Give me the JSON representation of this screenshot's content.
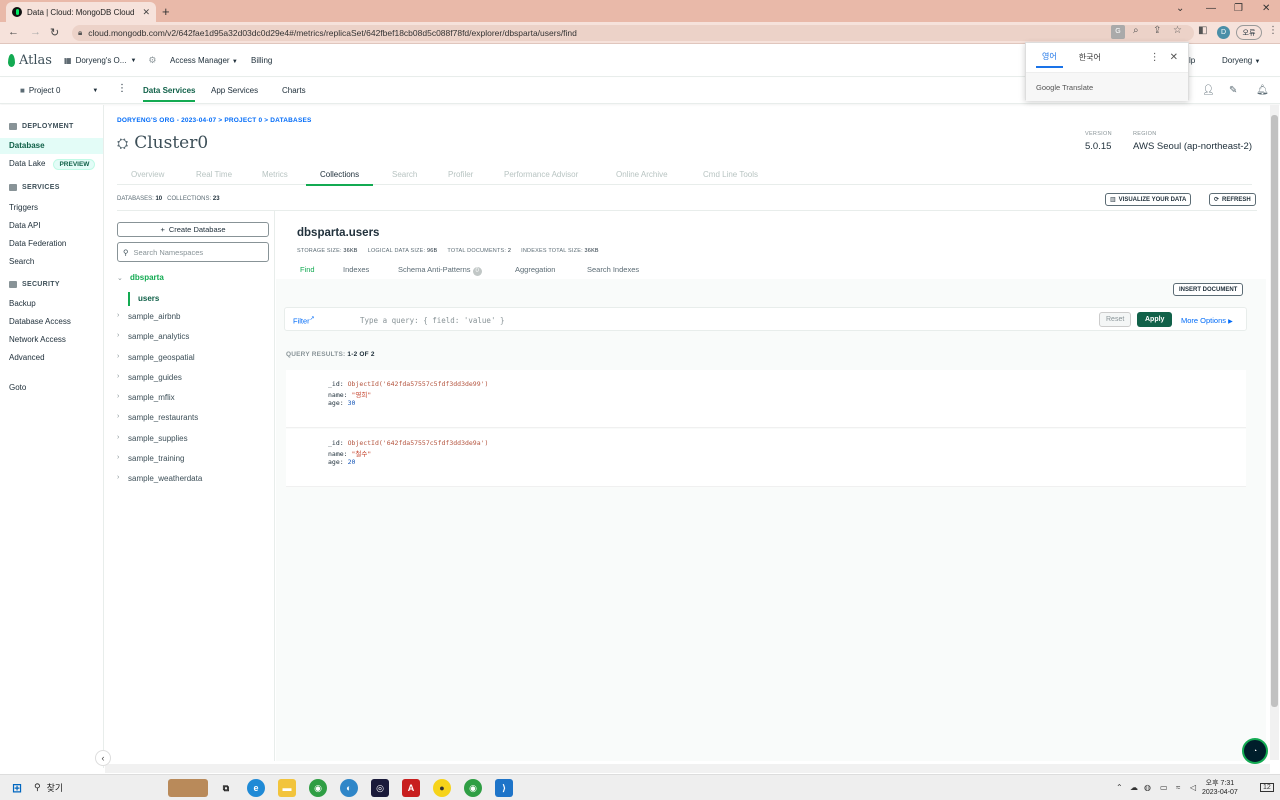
{
  "browser": {
    "tab_title": "Data | Cloud: MongoDB Cloud",
    "url": "cloud.mongodb.com/v2/642fae1d95a32d03dc0d29e4#/metrics/replicaSet/642fbef18cb08d5c088f78fd/explorer/dbsparta/users/find",
    "profile_initial": "D",
    "profile_btn": "오류"
  },
  "translate_popup": {
    "lang_source": "영어",
    "lang_target": "한국어",
    "brand": "Google Translate"
  },
  "atlas_nav": {
    "logo": "Atlas",
    "org": "Doryeng's O...",
    "access_manager": "Access Manager",
    "billing": "Billing",
    "help_partial": "lp",
    "user": "Doryeng"
  },
  "project_bar": {
    "project": "Project 0",
    "tabs": [
      "Data Services",
      "App Services",
      "Charts"
    ]
  },
  "sidebar": {
    "deployment_header": "DEPLOYMENT",
    "database": "Database",
    "data_lake": "Data Lake",
    "preview_badge": "PREVIEW",
    "services_header": "SERVICES",
    "triggers": "Triggers",
    "data_api": "Data API",
    "data_federation": "Data Federation",
    "search": "Search",
    "security_header": "SECURITY",
    "backup": "Backup",
    "database_access": "Database Access",
    "network_access": "Network Access",
    "advanced": "Advanced",
    "goto": "Goto"
  },
  "header": {
    "breadcrumb": "DORYENG'S ORG - 2023-04-07 > PROJECT 0 > DATABASES",
    "cluster_name": "Cluster0",
    "version_label": "VERSION",
    "version": "5.0.15",
    "region_label": "REGION",
    "region": "AWS Seoul (ap-northeast-2)"
  },
  "cluster_tabs": [
    "Overview",
    "Real Time",
    "Metrics",
    "Collections",
    "Search",
    "Profiler",
    "Performance Advisor",
    "Online Archive",
    "Cmd Line Tools"
  ],
  "counts": {
    "databases_label": "DATABASES:",
    "databases": "10",
    "collections_label": "COLLECTIONS:",
    "collections": "23",
    "visualize": "VISUALIZE YOUR DATA",
    "refresh": "REFRESH"
  },
  "namespaces": {
    "create_db": "Create Database",
    "search_placeholder": "Search Namespaces",
    "active_db": "dbsparta",
    "active_collection": "users",
    "databases": [
      "sample_airbnb",
      "sample_analytics",
      "sample_geospatial",
      "sample_guides",
      "sample_mflix",
      "sample_restaurants",
      "sample_supplies",
      "sample_training",
      "sample_weatherdata"
    ]
  },
  "collection": {
    "title": "dbsparta.users",
    "storage_size_label": "STORAGE SIZE:",
    "storage_size": "36KB",
    "logical_size_label": "LOGICAL DATA SIZE:",
    "logical_size": "96B",
    "total_docs_label": "TOTAL DOCUMENTS:",
    "total_docs": "2",
    "indexes_size_label": "INDEXES TOTAL SIZE:",
    "indexes_size": "36KB",
    "tabs": [
      "Find",
      "Indexes",
      "Schema Anti-Patterns",
      "Aggregation",
      "Search Indexes"
    ],
    "schema_badge": "0",
    "insert_document": "INSERT DOCUMENT",
    "filter_label": "Filter",
    "query_placeholder": "Type a query: { field: 'value' }",
    "reset": "Reset",
    "apply": "Apply",
    "more_options": "More Options",
    "results_label": "QUERY RESULTS:",
    "results_range": "1-2 OF 2"
  },
  "documents": [
    {
      "id_key": "_id:",
      "id_val": "ObjectId('642fda57557c5fdf3dd3de99')",
      "name_key": "name:",
      "name_val": "\"영희\"",
      "age_key": "age:",
      "age_val": "30"
    },
    {
      "id_key": "_id:",
      "id_val": "ObjectId('642fda57557c5fdf3dd3de9a')",
      "name_key": "name:",
      "name_val": "\"철수\"",
      "age_key": "age:",
      "age_val": "20"
    }
  ],
  "taskbar": {
    "search": "찾기",
    "time": "오후 7:31",
    "date": "2023-04-07",
    "notif": "12"
  }
}
